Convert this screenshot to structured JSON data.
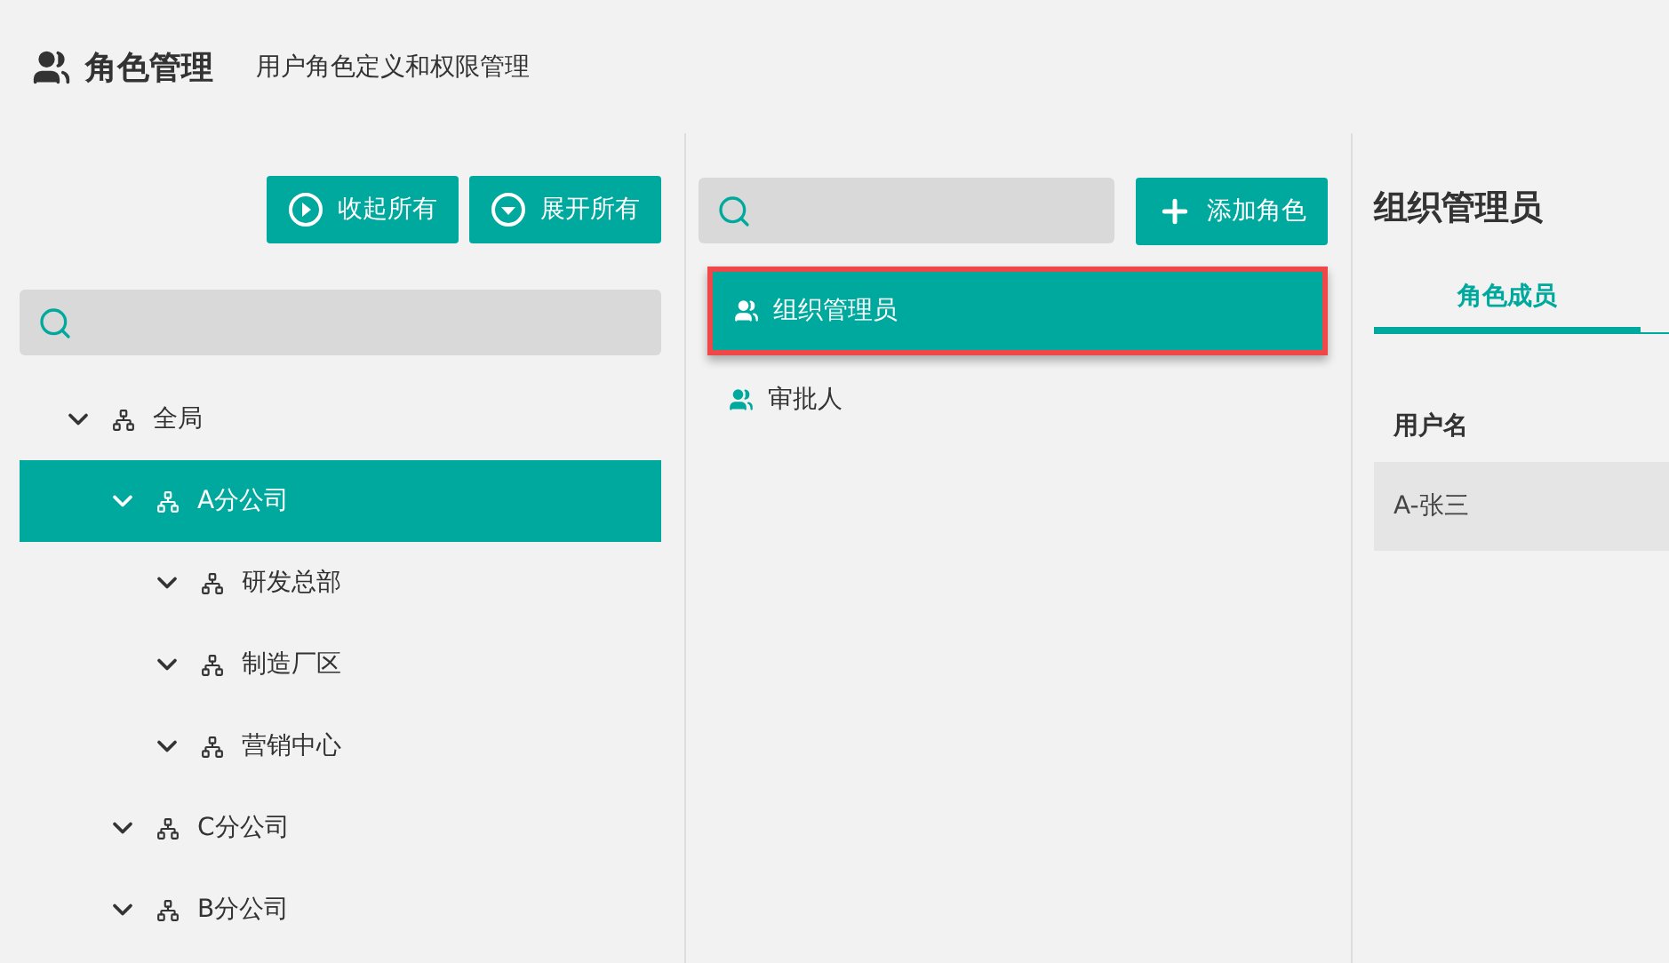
{
  "header": {
    "title": "角色管理",
    "subtitle": "用户角色定义和权限管理"
  },
  "org_panel": {
    "buttons": [
      {
        "label": "收起所有",
        "kind": "collapse"
      },
      {
        "label": "展开所有",
        "kind": "expand"
      }
    ],
    "tree": [
      {
        "label": "全局",
        "expanded": true,
        "selected": false,
        "children": [
          {
            "label": "A分公司",
            "expanded": true,
            "selected": true,
            "children": [
              {
                "label": "研发总部",
                "expanded": true,
                "selected": false
              },
              {
                "label": "制造厂区",
                "expanded": true,
                "selected": false
              },
              {
                "label": "营销中心",
                "expanded": true,
                "selected": false
              }
            ]
          },
          {
            "label": "C分公司",
            "expanded": true,
            "selected": false
          },
          {
            "label": "B分公司",
            "expanded": true,
            "selected": false
          }
        ]
      }
    ]
  },
  "roles_panel": {
    "add_button": "添加角色",
    "items": [
      {
        "label": "组织管理员",
        "selected": true
      },
      {
        "label": "审批人",
        "selected": false
      }
    ]
  },
  "detail_panel": {
    "title": "组织管理员",
    "tabs": [
      {
        "label": "角色成员",
        "selected": true
      }
    ],
    "table": {
      "columns": [
        "用户名"
      ],
      "rows": [
        [
          "A-张三"
        ]
      ]
    }
  }
}
